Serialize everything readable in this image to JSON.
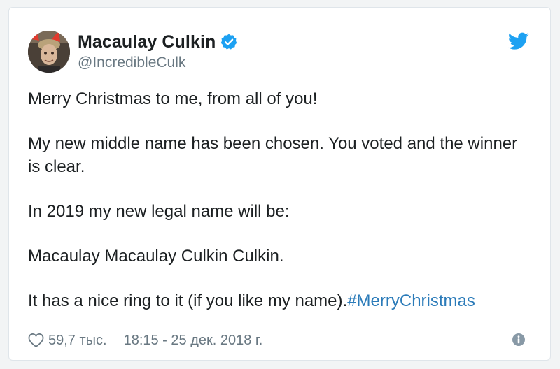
{
  "tweet": {
    "author": {
      "display_name": "Macaulay Culkin",
      "handle": "@IncredibleCulk",
      "avatar_icon": "profile-photo-avatar",
      "verified": true
    },
    "brand_icon": "twitter-bird-icon",
    "paragraphs": [
      "Merry Christmas to me, from all of you!",
      "My new middle name has been chosen. You voted and the winner is clear.",
      "In 2019 my new legal name will be:",
      "Macaulay Macaulay Culkin Culkin."
    ],
    "last_paragraph_text": "It has a nice ring to it (if you like my name).",
    "hashtag": "#MerryChristmas",
    "likes": "59,7 тыс.",
    "timestamp": "18:15 - 25 дек. 2018 г.",
    "colors": {
      "link": "#2b7bb9",
      "verified": "#1da1f2",
      "meta_text": "#697882",
      "text": "#1c2022"
    }
  }
}
